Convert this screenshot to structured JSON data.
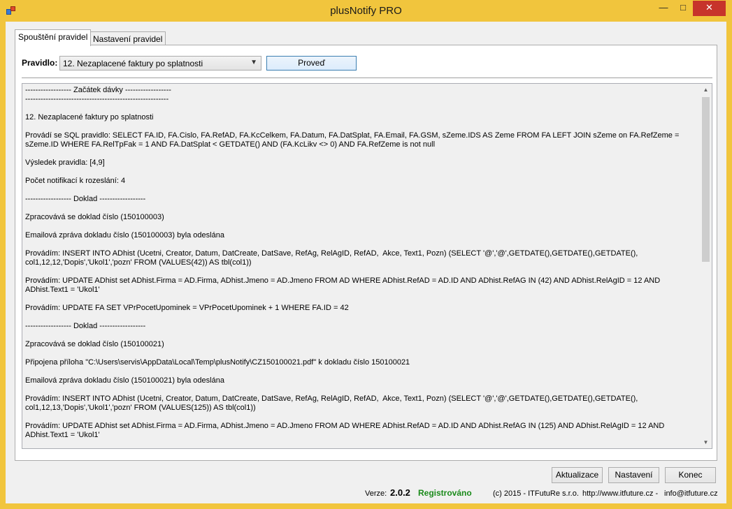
{
  "window": {
    "title": "plusNotify PRO",
    "minimize_glyph": "—",
    "maximize_glyph": "□",
    "close_glyph": "✕"
  },
  "tabs": [
    {
      "label": "Spouštění pravidel",
      "active": true
    },
    {
      "label": "Nastavení pravidel",
      "active": false
    }
  ],
  "rule": {
    "label": "Pravidlo:",
    "selected": "12. Nezaplacené faktury po splatnosti",
    "run_button": "Proveď"
  },
  "log": [
    "------------------ Začátek dávky ------------------",
    "--------------------------------------------------------",
    "",
    "12. Nezaplacené faktury po splatnosti",
    "",
    "Provádí se SQL pravidlo: SELECT FA.ID, FA.Cislo, FA.RefAD, FA.KcCelkem, FA.Datum, FA.DatSplat, FA.Email, FA.GSM, sZeme.IDS AS Zeme FROM FA LEFT JOIN sZeme on FA.RefZeme = sZeme.ID WHERE FA.RelTpFak = 1 AND FA.DatSplat < GETDATE() AND (FA.KcLikv <> 0) AND FA.RefZeme is not null",
    "",
    "Výsledek pravidla: [4,9]",
    "",
    "Počet notifikací k rozeslání: 4",
    "",
    "------------------ Doklad ------------------",
    "",
    "Zpracovává se doklad číslo (150100003)",
    "",
    "Emailová zpráva dokladu číslo (150100003) byla odeslána",
    "",
    "Provádím: INSERT INTO ADhist (Ucetni, Creator, Datum, DatCreate, DatSave, RefAg, RelAgID, RefAD,  Akce, Text1, Pozn) (SELECT '@','@',GETDATE(),GETDATE(),GETDATE(), col1,12,12,'Dopis','Ukol1','pozn' FROM (VALUES(42)) AS tbl(col1))",
    "",
    "Provádím: UPDATE ADhist set ADhist.Firma = AD.Firma, ADhist.Jmeno = AD.Jmeno FROM AD WHERE ADhist.RefAD = AD.ID AND ADhist.RefAG IN (42) AND ADhist.RelAgID = 12 AND ADhist.Text1 = 'Ukol1'",
    "",
    "Provádím: UPDATE FA SET VPrPocetUpominek = VPrPocetUpominek + 1 WHERE FA.ID = 42",
    "",
    "------------------ Doklad ------------------",
    "",
    "Zpracovává se doklad číslo (150100021)",
    "",
    "Připojena příloha \"C:\\Users\\servis\\AppData\\Local\\Temp\\plusNotify\\CZ150100021.pdf\" k dokladu číslo 150100021",
    "",
    "Emailová zpráva dokladu číslo (150100021) byla odeslána",
    "",
    "Provádím: INSERT INTO ADhist (Ucetni, Creator, Datum, DatCreate, DatSave, RefAg, RelAgID, RefAD,  Akce, Text1, Pozn) (SELECT '@','@',GETDATE(),GETDATE(),GETDATE(), col1,12,13,'Dopis','Ukol1','pozn' FROM (VALUES(125)) AS tbl(col1))",
    "",
    "Provádím: UPDATE ADhist set ADhist.Firma = AD.Firma, ADhist.Jmeno = AD.Jmeno FROM AD WHERE ADhist.RefAD = AD.ID AND ADhist.RefAG IN (125) AND ADhist.RelAgID = 12 AND ADhist.Text1 = 'Ukol1'"
  ],
  "buttons": {
    "refresh": "Aktualizace",
    "settings": "Nastavení",
    "end": "Konec"
  },
  "footer": {
    "version_label": "Verze:",
    "version_value": "2.0.2",
    "registration": "Registrováno",
    "copyright": "(c) 2015 - ITFutuRe s.r.o.",
    "website": "http://www.itfuture.cz -",
    "email": "info@itfuture.cz"
  },
  "colors": {
    "title_bar": "#f1c53d",
    "close_button": "#c7342b",
    "registered": "#1a8a1a"
  }
}
